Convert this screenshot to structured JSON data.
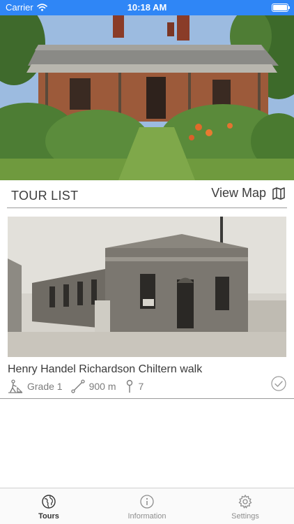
{
  "status_bar": {
    "carrier": "Carrier",
    "time": "10:18 AM"
  },
  "header": {
    "title": "TOUR LIST",
    "view_map_label": "View Map"
  },
  "tours": [
    {
      "name": "Henry Handel Richardson Chiltern walk",
      "grade": "Grade 1",
      "distance": "900 m",
      "stops": "7",
      "completed": true
    }
  ],
  "tab_bar": {
    "items": [
      {
        "label": "Tours",
        "icon": "globe-icon",
        "active": true
      },
      {
        "label": "Information",
        "icon": "info-icon",
        "active": false
      },
      {
        "label": "Settings",
        "icon": "gear-icon",
        "active": false
      }
    ]
  },
  "colors": {
    "status_bar": "#2f86f6",
    "divider": "#9a9a9a",
    "text": "#3a3a3a",
    "muted": "#7d7d7d"
  }
}
